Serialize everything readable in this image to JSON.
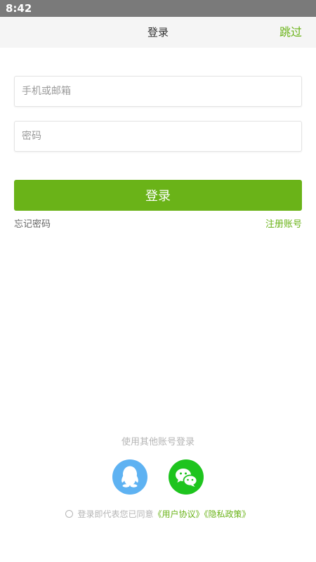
{
  "status_bar": {
    "time": "8:42"
  },
  "header": {
    "title": "登录",
    "skip_label": "跳过"
  },
  "form": {
    "account_placeholder": "手机或邮箱",
    "account_value": "",
    "password_placeholder": "密码",
    "password_value": "",
    "login_label": "登录",
    "forgot_label": "忘记密码",
    "register_label": "注册账号"
  },
  "social_login": {
    "label": "使用其他账号登录",
    "providers": [
      {
        "icon": "qq-icon",
        "color": "#5eb2f2"
      },
      {
        "icon": "wechat-icon",
        "color": "#1ec41e"
      }
    ]
  },
  "agreement": {
    "prefix": "登录即代表您已同意",
    "terms_label": "《用户协议》",
    "privacy_label": "《隐私政策》"
  },
  "colors": {
    "accent": "#6ab318",
    "status_bar": "#7a7a7a",
    "header_bg": "#f5f5f5"
  }
}
